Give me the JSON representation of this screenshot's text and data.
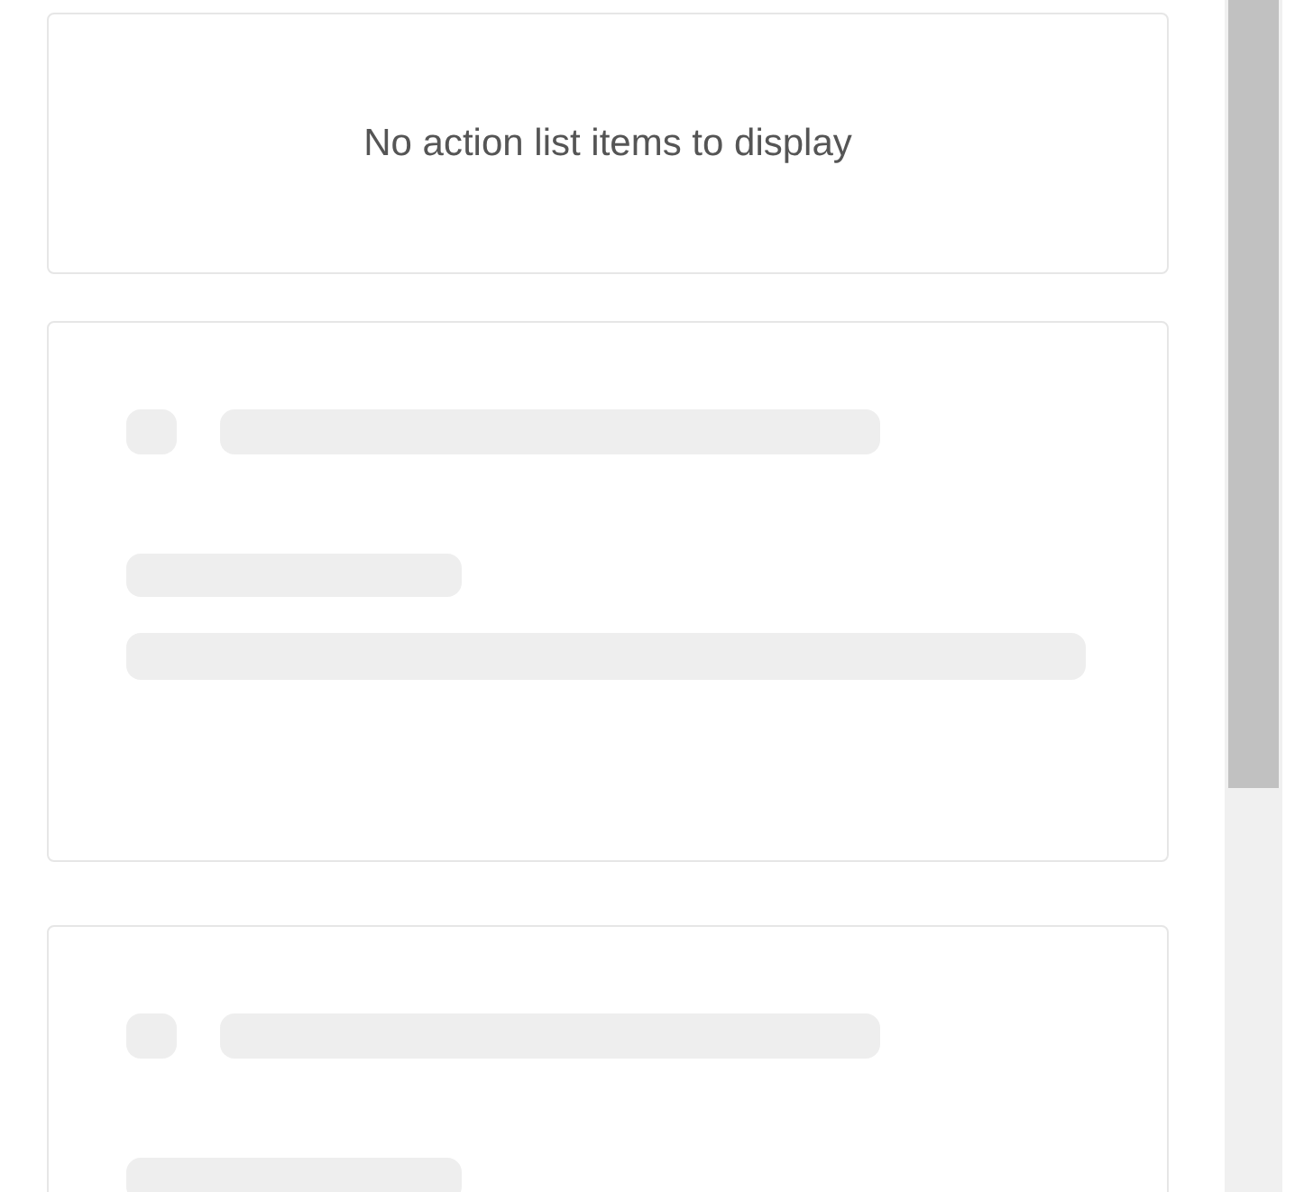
{
  "empty_message": "No action list items to display",
  "placeholder_cards": [
    {
      "kind": "skeleton"
    },
    {
      "kind": "skeleton"
    }
  ]
}
